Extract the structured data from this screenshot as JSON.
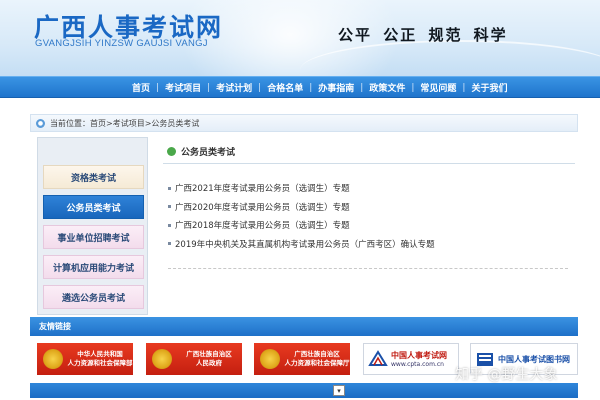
{
  "header": {
    "logo_cn": "广西人事考试网",
    "logo_en": "GVANGJSIH YINZSW GAUJSI VANGJ",
    "slogan": "公平 公正 规范 科学"
  },
  "nav": {
    "items": [
      "首页",
      "考试项目",
      "考试计划",
      "合格名单",
      "办事指南",
      "政策文件",
      "常见问题",
      "关于我们"
    ],
    "separator": "|"
  },
  "breadcrumb": {
    "prefix": "当前位置：",
    "items": [
      "首页",
      "考试项目",
      "公务员类考试"
    ],
    "separator": " > "
  },
  "sidebar": {
    "items": [
      {
        "label": "资格类考试",
        "active": false
      },
      {
        "label": "公务员类考试",
        "active": true
      },
      {
        "label": "事业单位招聘考试",
        "active": false
      },
      {
        "label": "计算机应用能力考试",
        "active": false
      },
      {
        "label": "遴选公务员考试",
        "active": false
      }
    ]
  },
  "main": {
    "section_title": "公务员类考试",
    "news": [
      "广西2021年度考试录用公务员（选调生）专题",
      "广西2020年度考试录用公务员（选调生）专题",
      "广西2018年度考试录用公务员（选调生）专题",
      "2019年中央机关及其直属机构考试录用公务员（广西考区）确认专题"
    ]
  },
  "links": {
    "title": "友情链接",
    "logos": [
      {
        "line1": "中华人民共和国",
        "line2": "人力资源和社会保障部"
      },
      {
        "line1": "广西壮族自治区",
        "line2": "人民政府"
      },
      {
        "line1": "广西壮族自治区",
        "line2": "人力资源和社会保障厅"
      },
      {
        "line1": "中国人事考试网",
        "line2": "www.cpta.com.cn"
      },
      {
        "line1": "中国人事考试图书网"
      }
    ]
  },
  "bottom": {
    "select_glyph": "▾"
  },
  "watermark": "知乎 @野生大象",
  "colors": {
    "brand_blue": "#1f74cc",
    "active_blue": "#1866bc",
    "logo_red": "#c41f10"
  }
}
